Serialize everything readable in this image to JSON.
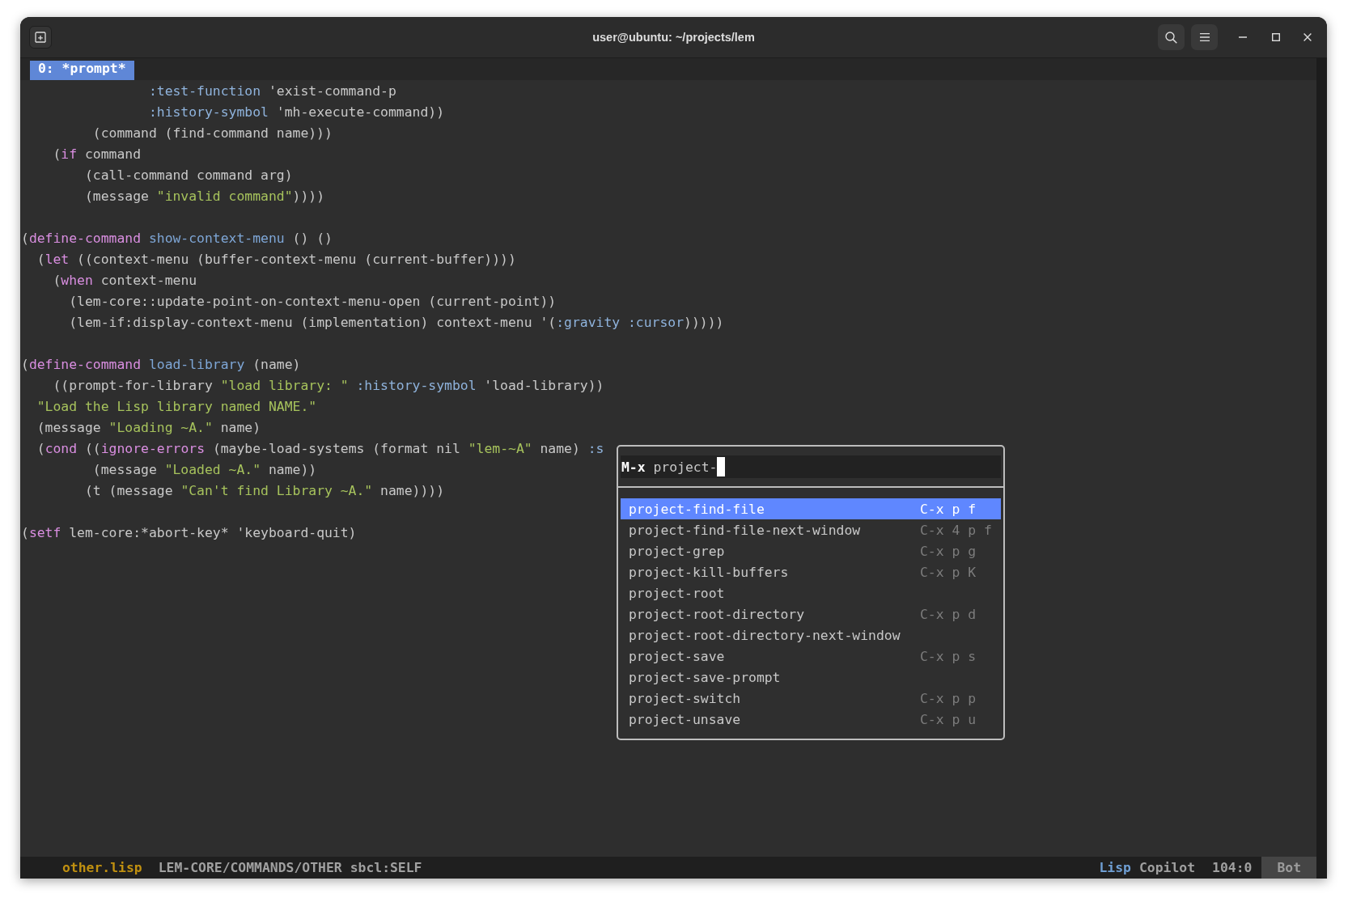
{
  "window": {
    "title": "user@ubuntu: ~/projects/lem"
  },
  "frame_tabs": [
    {
      "label": "0: *prompt*",
      "selected": true
    }
  ],
  "editor": {
    "lines": [
      {
        "kind": "code",
        "segments": [
          {
            "kind": "keyword",
            "text": "                :test-function"
          },
          {
            "kind": "plain",
            "text": " 'exist-command-p"
          }
        ]
      },
      {
        "kind": "code",
        "segments": [
          {
            "kind": "keyword",
            "text": "                :history-symbol"
          },
          {
            "kind": "plain",
            "text": " 'mh-execute-command))"
          }
        ]
      },
      {
        "kind": "code",
        "segments": [
          {
            "kind": "plain",
            "text": "         (command (find-command name)))"
          }
        ]
      },
      {
        "kind": "code",
        "segments": [
          {
            "kind": "plain",
            "text": "    ("
          },
          {
            "kind": "macro",
            "text": "if"
          },
          {
            "kind": "plain",
            "text": " command"
          }
        ]
      },
      {
        "kind": "code",
        "segments": [
          {
            "kind": "plain",
            "text": "        (call-command command arg)"
          }
        ]
      },
      {
        "kind": "code",
        "segments": [
          {
            "kind": "plain",
            "text": "        (message "
          },
          {
            "kind": "string",
            "text": "\"invalid command\""
          },
          {
            "kind": "plain",
            "text": "))))"
          }
        ]
      },
      {
        "kind": "blank"
      },
      {
        "kind": "code",
        "segments": [
          {
            "kind": "plain",
            "text": "("
          },
          {
            "kind": "macro",
            "text": "define-command"
          },
          {
            "kind": "function-name",
            "text": " show-context-menu"
          },
          {
            "kind": "plain",
            "text": " () ()"
          }
        ]
      },
      {
        "kind": "code",
        "segments": [
          {
            "kind": "plain",
            "text": "  ("
          },
          {
            "kind": "macro",
            "text": "let"
          },
          {
            "kind": "plain",
            "text": " ((context-menu (buffer-context-menu (current-buffer))))"
          }
        ]
      },
      {
        "kind": "code",
        "segments": [
          {
            "kind": "plain",
            "text": "    ("
          },
          {
            "kind": "macro",
            "text": "when"
          },
          {
            "kind": "plain",
            "text": " context-menu"
          }
        ]
      },
      {
        "kind": "code",
        "segments": [
          {
            "kind": "plain",
            "text": "      (lem-core::update-point-on-context-menu-open (current-point))"
          }
        ]
      },
      {
        "kind": "code",
        "segments": [
          {
            "kind": "plain",
            "text": "      (lem-if:display-context-menu (implementation) context-menu '("
          },
          {
            "kind": "keyword",
            "text": ":gravity :cursor"
          },
          {
            "kind": "plain",
            "text": ")))))"
          }
        ]
      },
      {
        "kind": "blank"
      },
      {
        "kind": "code",
        "segments": [
          {
            "kind": "plain",
            "text": "("
          },
          {
            "kind": "macro",
            "text": "define-command"
          },
          {
            "kind": "function-name",
            "text": " load-library"
          },
          {
            "kind": "plain",
            "text": " (name)"
          }
        ]
      },
      {
        "kind": "code",
        "segments": [
          {
            "kind": "plain",
            "text": "    ((prompt-for-library "
          },
          {
            "kind": "string",
            "text": "\"load library: \""
          },
          {
            "kind": "keyword",
            "text": " :history-symbol"
          },
          {
            "kind": "plain",
            "text": " 'load-library))"
          }
        ]
      },
      {
        "kind": "code",
        "segments": [
          {
            "kind": "string",
            "text": "  \"Load the Lisp library named NAME.\""
          }
        ]
      },
      {
        "kind": "code",
        "segments": [
          {
            "kind": "plain",
            "text": "  (message "
          },
          {
            "kind": "string",
            "text": "\"Loading ~A.\""
          },
          {
            "kind": "plain",
            "text": " name)"
          }
        ]
      },
      {
        "kind": "code",
        "segments": [
          {
            "kind": "plain",
            "text": "  ("
          },
          {
            "kind": "macro",
            "text": "cond"
          },
          {
            "kind": "plain",
            "text": " (("
          },
          {
            "kind": "macro",
            "text": "ignore-errors"
          },
          {
            "kind": "plain",
            "text": " (maybe-load-systems (format nil "
          },
          {
            "kind": "string",
            "text": "\"lem-~A\""
          },
          {
            "kind": "plain",
            "text": " name) "
          },
          {
            "kind": "keyword",
            "text": ":s"
          }
        ]
      },
      {
        "kind": "code",
        "segments": [
          {
            "kind": "plain",
            "text": "         (message "
          },
          {
            "kind": "string",
            "text": "\"Loaded ~A.\""
          },
          {
            "kind": "plain",
            "text": " name))"
          }
        ]
      },
      {
        "kind": "code",
        "segments": [
          {
            "kind": "plain",
            "text": "        (t (message "
          },
          {
            "kind": "string",
            "text": "\"Can't find Library ~A.\""
          },
          {
            "kind": "plain",
            "text": " name))))"
          }
        ]
      },
      {
        "kind": "blank"
      },
      {
        "kind": "code",
        "segments": [
          {
            "kind": "plain",
            "text": "("
          },
          {
            "kind": "macro",
            "text": "setf"
          },
          {
            "kind": "plain",
            "text": " lem-core:*abort-key* 'keyboard-quit)"
          }
        ]
      }
    ]
  },
  "command_prompt": {
    "prefix": "M-x",
    "value": "project-"
  },
  "completions": [
    {
      "name": "project-find-file",
      "keys": "C-x p f",
      "selected": true
    },
    {
      "name": "project-find-file-next-window",
      "keys": "C-x 4 p f",
      "selected": false
    },
    {
      "name": "project-grep",
      "keys": "C-x p g",
      "selected": false
    },
    {
      "name": "project-kill-buffers",
      "keys": "C-x p K",
      "selected": false
    },
    {
      "name": "project-root",
      "selected": false
    },
    {
      "name": "project-root-directory",
      "keys": "C-x p d",
      "selected": false
    },
    {
      "name": "project-root-directory-next-window",
      "selected": false
    },
    {
      "name": "project-save",
      "keys": "C-x p s",
      "selected": false
    },
    {
      "name": "project-save-prompt",
      "selected": false
    },
    {
      "name": "project-switch",
      "keys": "C-x p p",
      "selected": false
    },
    {
      "name": "project-unsave",
      "keys": "C-x p u",
      "selected": false
    }
  ],
  "mode_line": {
    "file": "other.lisp",
    "package": "LEM-CORE/COMMANDS/OTHER",
    "implementation": "sbcl:SELF",
    "major_mode": "Lisp",
    "minor_mode": "Copilot",
    "position": "104:0",
    "scroll": "Bot"
  }
}
